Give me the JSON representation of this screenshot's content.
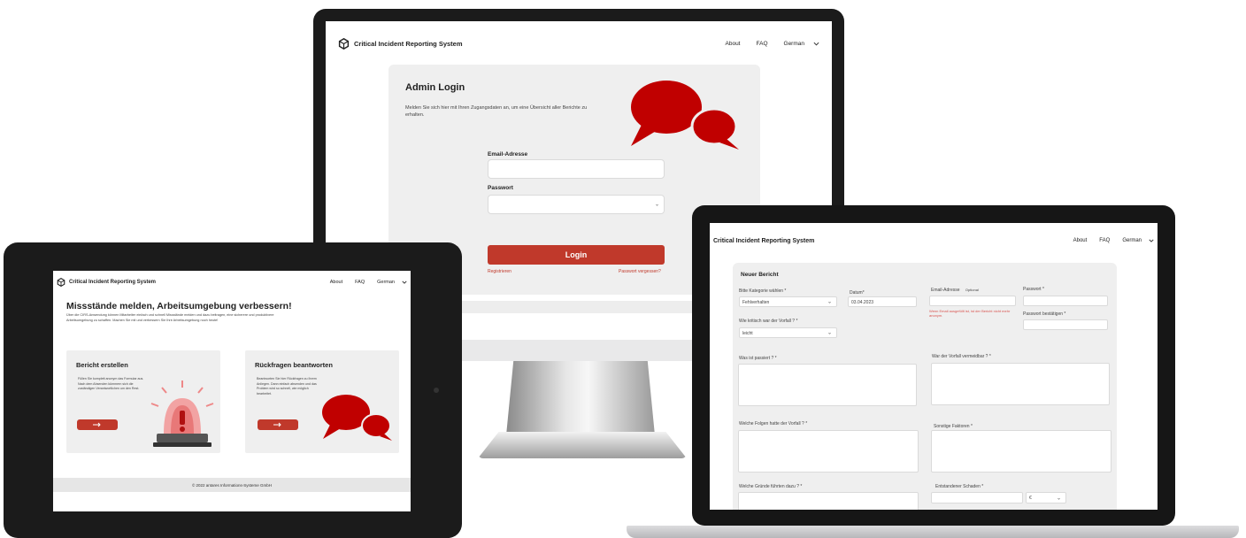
{
  "brand": {
    "title": "Critical Incident Reporting System",
    "accent_color": "#c0392b",
    "logo_icon": "cube-logo-icon"
  },
  "nav": {
    "about": "About",
    "faq": "FAQ",
    "language": "German",
    "language_icon": "chevron-down-icon"
  },
  "monitor": {
    "login": {
      "heading": "Admin Login",
      "intro": "Melden Sie sich hier mit Ihren Zugangsdaten an, um eine Übersicht aller Berichte zu erhalten.",
      "email_label": "Email-Adresse",
      "email_value": "",
      "password_label": "Passwort",
      "password_value": "",
      "login_button": "Login",
      "register_link": "Registrieren",
      "forgot_link": "Passwort vergessen?",
      "illustration_icon": "speech-bubbles-icon"
    }
  },
  "tablet": {
    "hero_title": "Missstände melden, Arbeitsumgebung verbessern!",
    "hero_text": "Über die CIRS-Anwendung können Mitarbeiter einfach und schnell Missstände melden und dazu beitragen, eine sicherere und produktivere Arbeitsumgebung zu schaffen. Machen Sie mit und verbessern Sie Ihre Arbeitsumgebung noch heute!",
    "card1": {
      "title": "Bericht erstellen",
      "text": "Füllen Sie komplett anonym das Formular aus. Nach dem Absenden kümmern sich die zuständigen Verantwortlichen um den Rest.",
      "icon": "alarm-siren-icon",
      "button_icon": "arrow-right-icon"
    },
    "card2": {
      "title": "Rückfragen beantworten",
      "text": "Beantworten Sie hier Rückfragen zu Ihrem Anliegen. Dann einfach absenden und das Problem wird so schnell, wie möglich bearbeitet.",
      "icon": "speech-bubbles-icon",
      "button_icon": "arrow-right-icon"
    },
    "footer": "© 2022 antares Informations-Systeme GmbH"
  },
  "laptop": {
    "form_title": "Neuer Bericht",
    "category_label": "Bitte Kategorie wählen *",
    "category_value": "Fehlverhalten",
    "date_label": "Datum*",
    "date_value": "03.04.2023",
    "email_label": "Email-Adresse",
    "email_optional": "Optional",
    "email_value": "",
    "email_warning": "Wenn Email ausgefüllt ist, ist der Bericht nicht mehr anonym.",
    "password_label": "Passwort *",
    "password_confirm_label": "Passwort bestätigen *",
    "critical_label": "Wie kritisch war der Vorfall ? *",
    "critical_value": "leicht",
    "what_happened_label": "Was ist passiert ? *",
    "avoidable_label": "War der Vorfall vermeidbar ? *",
    "consequences_label": "Welche Folgen hatte der Vorfall ? *",
    "other_factors_label": "Sonstige Faktoren *",
    "reasons_label": "Welche Gründe führten dazu ? *",
    "damage_label": "Entstandener Schaden *",
    "currency_value": "€"
  }
}
